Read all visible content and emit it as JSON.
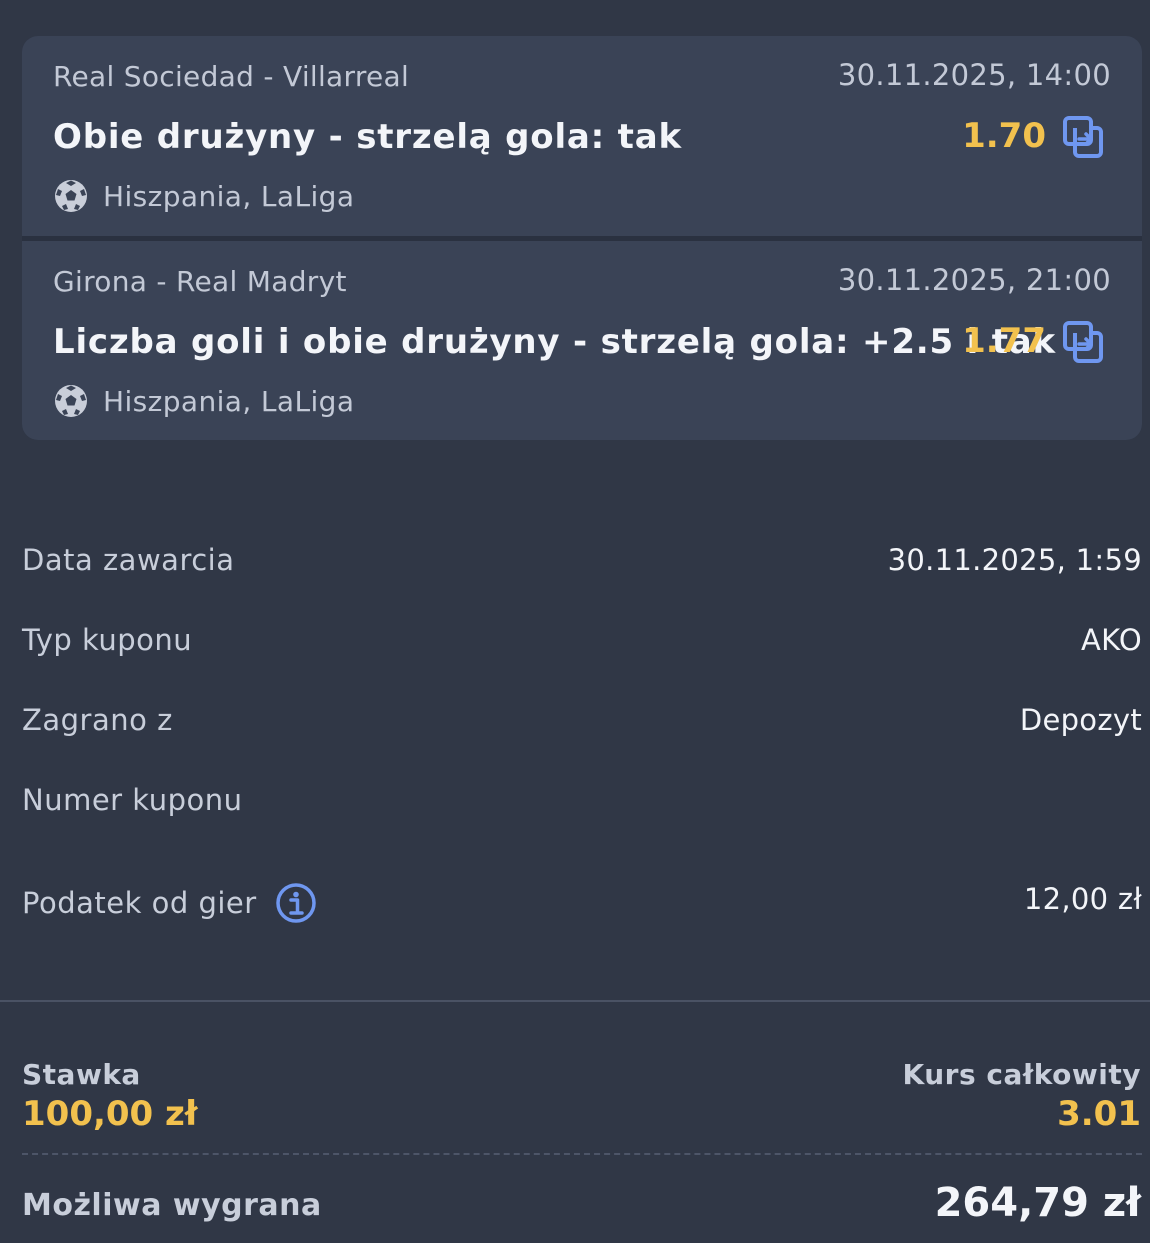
{
  "events": [
    {
      "match": "Real Sociedad - Villarreal",
      "datetime": "30.11.2025, 14:00",
      "market": "Obie drużyny - strzelą gola: tak",
      "odds": "1.70",
      "league": "Hiszpania, LaLiga",
      "sport_icon": "football-icon",
      "action_icon": "copy-icon"
    },
    {
      "match": "Girona - Real Madryt",
      "datetime": "30.11.2025, 21:00",
      "market": "Liczba goli i obie drużyny - strzelą gola: +2.5 i tak",
      "odds": "1.77",
      "league": "Hiszpania, LaLiga",
      "sport_icon": "football-icon",
      "action_icon": "copy-icon"
    }
  ],
  "details": {
    "date_label": "Data zawarcia",
    "date_value": "30.11.2025, 1:59",
    "type_label": "Typ kuponu",
    "type_value": "AKO",
    "played_label": "Zagrano z",
    "played_value": "Depozyt",
    "number_label": "Numer kuponu",
    "number_value": "",
    "tax_label": "Podatek od gier",
    "tax_value": "12,00 zł"
  },
  "summary": {
    "stake_label": "Stawka",
    "stake_value": "100,00 zł",
    "total_odds_label": "Kurs całkowity",
    "total_odds_value": "3.01",
    "win_label": "Możliwa wygrana",
    "win_value": "264,79 zł"
  },
  "colors": {
    "background": "#303746",
    "card": "#3a4356",
    "accent_odds": "#f2c14e",
    "icon_blue": "#6f97f0"
  }
}
